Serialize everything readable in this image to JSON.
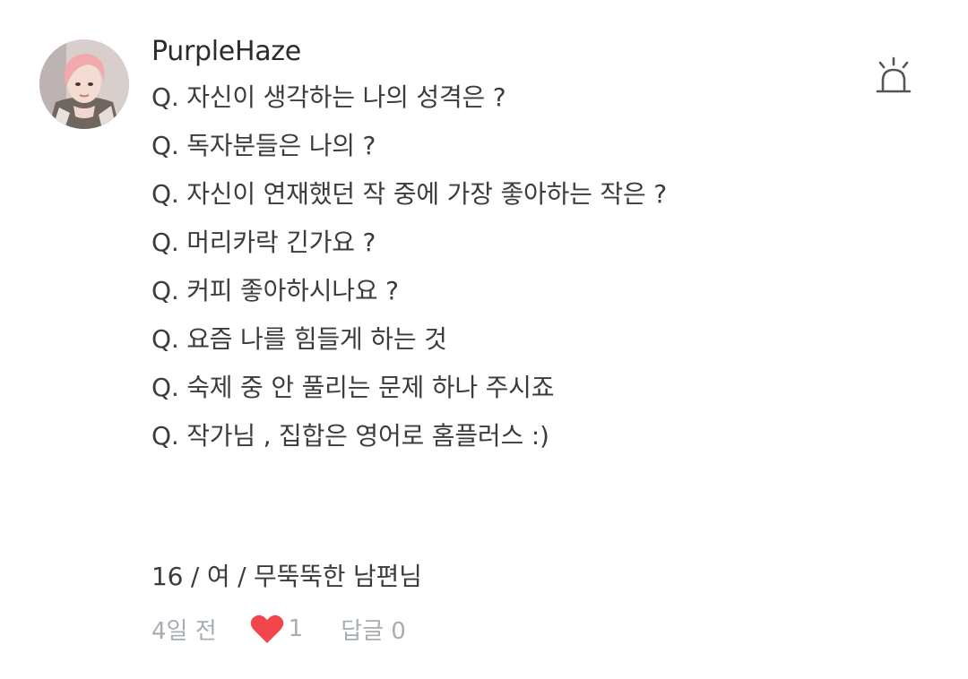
{
  "post": {
    "author": "PurpleHaze",
    "avatar_icon": "user-avatar-photo",
    "report_icon": "siren-icon",
    "questions": [
      "Q. 자신이 생각하는 나의 성격은 ?",
      "Q. 독자분들은 나의 ?",
      "Q. 자신이 연재했던 작 중에 가장 좋아하는 작은 ?",
      "Q. 머리카락 긴가요 ?",
      "Q. 커피 좋아하시나요 ?",
      "Q. 요즘 나를 힘들게 하는 것",
      "Q. 숙제 중 안 풀리는 문제 하나 주시죠",
      "Q. 작가님 , 집합은 영어로 홈플러스 :)"
    ],
    "profile_line": "16 / 여 / 무뚝뚝한 남편님",
    "time_ago": "4일 전",
    "likes": "1",
    "comments_label": "답글 0",
    "like_color": "#f0464c"
  }
}
